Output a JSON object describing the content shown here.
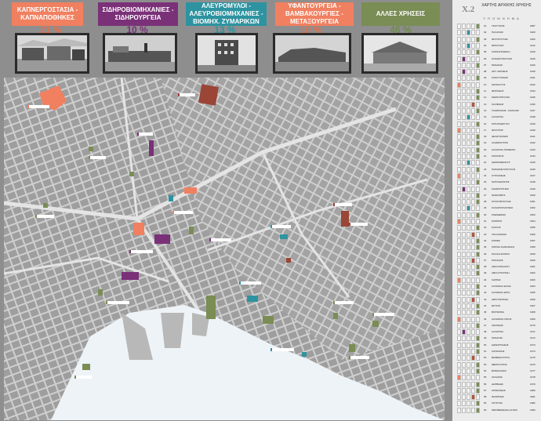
{
  "categories": [
    {
      "label": "ΚΑΠΝΕΡΓΟΣΤΑΣΙΑ - ΚΑΠΝΑΠΟΘΗΚΕΣ",
      "percent": "21 %",
      "color": "#f08060",
      "pct_color": "#e0704f"
    },
    {
      "label": "ΣΙΔΗΡΟΒΙΟΜΗΧΑΝΙΕΣ - ΣΙΔΗΡΟΥΡΓΕΙΑ",
      "percent": "10 %",
      "color": "#7a3178",
      "pct_color": "#7a3178"
    },
    {
      "label": "ΑΛΕΥΡΟΜΥΛΟΙ - ΑΛΕΥΡΟΒΙΟΜΗΧΑΝΙΕΣ - ΒΙΟΜΗΧ. ΖΥΜΑΡΙΚΩΝ",
      "percent": "13 %",
      "color": "#2d93a0",
      "pct_color": "#2d93a0"
    },
    {
      "label": "ΥΦΑΝΤΟΥΡΓΕΙΑ - ΒΑΜΒΑΚΟΥΡΓΙΕΣ - ΜΕΤΑΞΟΥΡΓΕΙΑ",
      "percent": "10 %",
      "color": "#f08060",
      "pct_color": "#e0704f"
    },
    {
      "label": "ΑΛΛΕΣ ΧΡΗΣΕΙΣ",
      "percent": "46 %",
      "color": "#7a8d55",
      "pct_color": "#6e8a4d"
    }
  ],
  "sidebar": {
    "code": "Χ.2",
    "title": "ΧΑΡΤΗΣ ΑΡΧΙΚΗΣ ΧΡΗΣΗΣ",
    "header": "Υ Π Ο Μ Ν Η Μ Α"
  },
  "legend_colors": {
    "tobacco": "#f08060",
    "iron": "#7a3178",
    "flour": "#2d93a0",
    "textile": "#b5523a",
    "other": "#7a8d55",
    "empty": "#f4f4f4"
  },
  "legend": [
    {
      "num": "01",
      "name": "ΤΣΟΥΤΣΙΟΣ",
      "year": "1887",
      "col": 4
    },
    {
      "num": "02",
      "name": "ΠΑΛΑΙΚΗΣ",
      "year": "1900",
      "col": 2
    },
    {
      "num": "03",
      "name": "ΦΟΥΝΤΟΥΚΗΣ",
      "year": "1905",
      "col": 4
    },
    {
      "num": "04",
      "name": "ΜΠΟΥΛΙΑΣ",
      "year": "1912",
      "col": 2
    },
    {
      "num": "05",
      "name": "ΚΑΠΝΑΠΟΘΗΚΗ",
      "year": "1920",
      "col": 4
    },
    {
      "num": "06",
      "name": "ΣΤΑΜΑΤΟΠΟΥΛΟΣ",
      "year": "1925",
      "col": 1
    },
    {
      "num": "07",
      "name": "ΜΟΔΙΑΝΟ",
      "year": "1926",
      "col": 4
    },
    {
      "num": "08",
      "name": "ΑΝΤ. ΖΑΡΙΦΗΣ",
      "year": "1930",
      "col": 1
    },
    {
      "num": "09",
      "name": "ΚΑΠΟΥΤΖΙΔΗΣ",
      "year": "1931",
      "col": 4
    },
    {
      "num": "10",
      "name": "ΜΑΤΣΑΓΓΟΣ",
      "year": "1932",
      "col": 0
    },
    {
      "num": "11",
      "name": "ΦΩΤΙΑΔΗΣ",
      "year": "1934",
      "col": 4
    },
    {
      "num": "12",
      "name": "ΜΑΡΚΟΠΟΥΛΟΣ",
      "year": "1935",
      "col": 4
    },
    {
      "num": "13",
      "name": "ΚΑΛΦΙΔΗΣ",
      "year": "1936",
      "col": 3
    },
    {
      "num": "14",
      "name": "ΓΚΑΜΠΑΝΗΣ - ΚΑΖΑΛΗΣ",
      "year": "1937",
      "col": 4
    },
    {
      "num": "15",
      "name": "ΑΛΛΑΤΙΝΗ",
      "year": "1938",
      "col": 2
    },
    {
      "num": "16",
      "name": "ΠΑΠΑΓΕΩΡΓΙΟΥ",
      "year": "1939",
      "col": 4
    },
    {
      "num": "17",
      "name": "ΦΛΟΥΡΟΣ",
      "year": "1940",
      "col": 0
    },
    {
      "num": "18",
      "name": "ΔΕΛΗΓΙΑΝΝΗΣ",
      "year": "1941",
      "col": 4
    },
    {
      "num": "19",
      "name": "ΑΛΑΜΠΟΥΡΟΣ",
      "year": "1942",
      "col": 4
    },
    {
      "num": "20",
      "name": "ΑΛΛΑΤΙΝΗ ΤΣΙΜΕΝΤΑ",
      "year": "1943",
      "col": 4
    },
    {
      "num": "21",
      "name": "ΚΟΚΚΙΝΟΣ",
      "year": "1944",
      "col": 4
    },
    {
      "num": "22",
      "name": "ΔΗΜΟΣΘΕΝΟΥΣ",
      "year": "1945",
      "col": 2
    },
    {
      "num": "23",
      "name": "ΠΑΡΑΣΚΕΥΟΠΟΥΛΟΣ",
      "year": "1946",
      "col": 4
    },
    {
      "num": "24",
      "name": "ΚΥΡΙΑΚΙΔΗΣ",
      "year": "1947",
      "col": 0
    },
    {
      "num": "25",
      "name": "ΝΑΠΟΛΕΟΝΤΑΣ",
      "year": "1948",
      "col": 4
    },
    {
      "num": "26",
      "name": "ΣΙΔΗΡΟΥΡΓΕΙΟ",
      "year": "1949",
      "col": 1
    },
    {
      "num": "27",
      "name": "ΜΟΣΚΟΒΙΤΣ",
      "year": "1950",
      "col": 4
    },
    {
      "num": "28",
      "name": "ΣΤΡΟΥΜΠΟΥΛΗΣ",
      "year": "1951",
      "col": 4
    },
    {
      "num": "29",
      "name": "ΣΑΧΑΡΟΠΛΑΣΤΕΙΟ",
      "year": "1952",
      "col": 2
    },
    {
      "num": "30",
      "name": "ΣΚΕΝΔΕΡΗΣ",
      "year": "1953",
      "col": 4
    },
    {
      "num": "31",
      "name": "ΡΟΜΠΟΣ",
      "year": "1954",
      "col": 0
    },
    {
      "num": "32",
      "name": "ΣΑΓΚΟΣ",
      "year": "1955",
      "col": 4
    },
    {
      "num": "33",
      "name": "ΤΣΑΛΑΠΑΤΑΣ",
      "year": "1956",
      "col": 3
    },
    {
      "num": "34",
      "name": "ΣΠΙΡΕΡ",
      "year": "1957",
      "col": 4
    },
    {
      "num": "35",
      "name": "ΚΟΡΝΙΑ ΚΑΝΣΙΝΑΚΗ",
      "year": "1958",
      "col": 4
    },
    {
      "num": "36",
      "name": "ΠΑΛΑΙΑ ΕΤΑΙΡΙΑ",
      "year": "1959",
      "col": 4
    },
    {
      "num": "37",
      "name": "ΠΑΠΑΝΟΣ",
      "year": "1960",
      "col": 3
    },
    {
      "num": "38",
      "name": "ΑΦΟΙ ΜΠΑΛΚΟΥ",
      "year": "1961",
      "col": 4
    },
    {
      "num": "39",
      "name": "ΑΦΟΙ ΣΤΑΥΡΙΔΗ",
      "year": "1962",
      "col": 4
    },
    {
      "num": "40",
      "name": "ΚΑΡΡΑΣ",
      "year": "1963",
      "col": 0
    },
    {
      "num": "41",
      "name": "ΑΛΛΗΝΙΚΑ ΕΛΑΙΑ",
      "year": "1964",
      "col": 4
    },
    {
      "num": "42",
      "name": "ΑΛΛΗΝΙΚΑ ΕΡΓΑ",
      "year": "1965",
      "col": 4
    },
    {
      "num": "43",
      "name": "ΑΦΟΙ ΠΕΤΡΙΔΗ",
      "year": "1966",
      "col": 3
    },
    {
      "num": "44",
      "name": "ΕΣΤΙΟΝ",
      "year": "1967",
      "col": 4
    },
    {
      "num": "45",
      "name": "ΒΙΟΤΕΧΝΙΑ",
      "year": "1968",
      "col": 4
    },
    {
      "num": "46",
      "name": "ΑΛΛΗΝΙΚΗ ΟΙΚΟΣ",
      "year": "1969",
      "col": 0
    },
    {
      "num": "47",
      "name": "ΑΡΑΠΙΔΗΣ",
      "year": "1970",
      "col": 4
    },
    {
      "num": "48",
      "name": "ΑΛΛΑΤΙΝΗ",
      "year": "1971",
      "col": 1
    },
    {
      "num": "49",
      "name": "ΠΑΝΑΓΗΣ",
      "year": "1972",
      "col": 4
    },
    {
      "num": "50",
      "name": "ΔΗΜΗΤΡΙΑΔΗΣ",
      "year": "1973",
      "col": 4
    },
    {
      "num": "51",
      "name": "ΚΑΤΣΙΑΝΗΣ",
      "year": "1974",
      "col": 4
    },
    {
      "num": "52",
      "name": "ΒΑΜΒΑΚΟΥΡΓΙΑ",
      "year": "1975",
      "col": 3
    },
    {
      "num": "53",
      "name": "ΜΕΡΚΟΥΡΙΟΣ",
      "year": "1976",
      "col": 4
    },
    {
      "num": "54",
      "name": "ΒΙΟΜΗΧΑΝΙΑ",
      "year": "1977",
      "col": 4
    },
    {
      "num": "55",
      "name": "ΖΑΧΑΡΗΣ",
      "year": "1978",
      "col": 0
    },
    {
      "num": "56",
      "name": "ΔΑΡΒΙΔΗΣ",
      "year": "1979",
      "col": 4
    },
    {
      "num": "57",
      "name": "ΟΡΦΑΝΙΔΗΣ",
      "year": "1980",
      "col": 4
    },
    {
      "num": "58",
      "name": "ΦΛΩΡΙΝΗΣ",
      "year": "1981",
      "col": 3
    },
    {
      "num": "59",
      "name": "ΚΟΥΡΤΗΣ",
      "year": "1982",
      "col": 4
    },
    {
      "num": "60",
      "name": "ΠΕΡΙΦΕΡΕΙΑΚΗ ΑΓΟΡΑ",
      "year": "1983",
      "col": 4
    }
  ]
}
